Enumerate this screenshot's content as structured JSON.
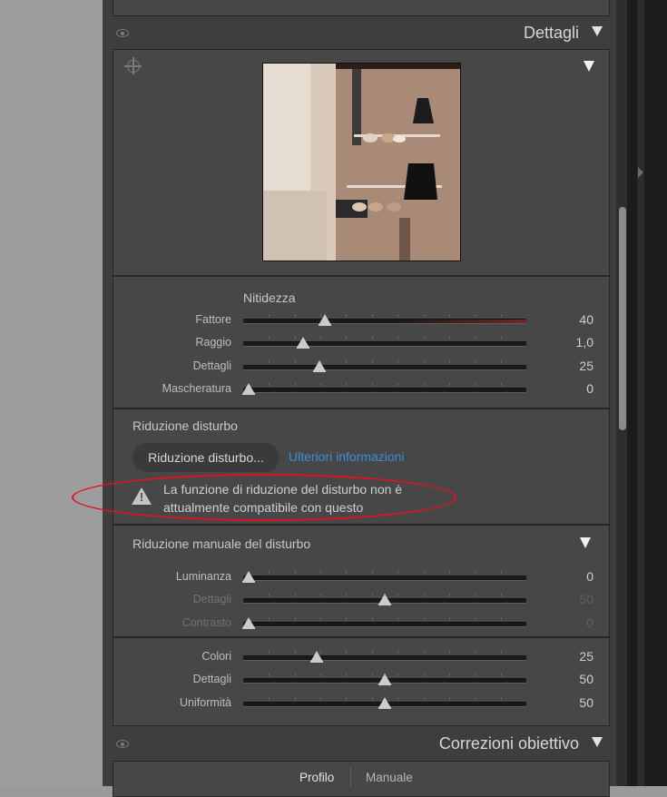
{
  "sections": {
    "details": {
      "title": "Dettagli"
    },
    "lens": {
      "title": "Correzioni obiettivo"
    }
  },
  "sharpening": {
    "title": "Nitidezza",
    "sliders": [
      {
        "label": "Fattore",
        "value": "40",
        "fraction": 0.29
      },
      {
        "label": "Raggio",
        "value": "1,0",
        "fraction": 0.21
      },
      {
        "label": "Dettagli",
        "value": "25",
        "fraction": 0.27
      },
      {
        "label": "Mascheratura",
        "value": "0",
        "fraction": 0.02
      }
    ]
  },
  "noise_reduction": {
    "title": "Riduzione disturbo",
    "button": "Riduzione disturbo...",
    "link": "Ulteriori informazioni",
    "warning": "La funzione di riduzione del disturbo non è attualmente compatibile con questo"
  },
  "manual_noise": {
    "title": "Riduzione manuale del disturbo",
    "luminance": [
      {
        "label": "Luminanza",
        "value": "0",
        "fraction": 0.02,
        "dim": false
      },
      {
        "label": "Dettagli",
        "value": "50",
        "fraction": 0.5,
        "dim": true
      },
      {
        "label": "Contrasto",
        "value": "0",
        "fraction": 0.02,
        "dim": true
      }
    ],
    "color": [
      {
        "label": "Colori",
        "value": "25",
        "fraction": 0.26
      },
      {
        "label": "Dettagli",
        "value": "50",
        "fraction": 0.5
      },
      {
        "label": "Uniformità",
        "value": "50",
        "fraction": 0.5
      }
    ]
  },
  "tabs": {
    "profile": "Profilo",
    "manual": "Manuale"
  },
  "colors": {
    "annotation": "#e0131f",
    "link": "#3b8ed4"
  }
}
